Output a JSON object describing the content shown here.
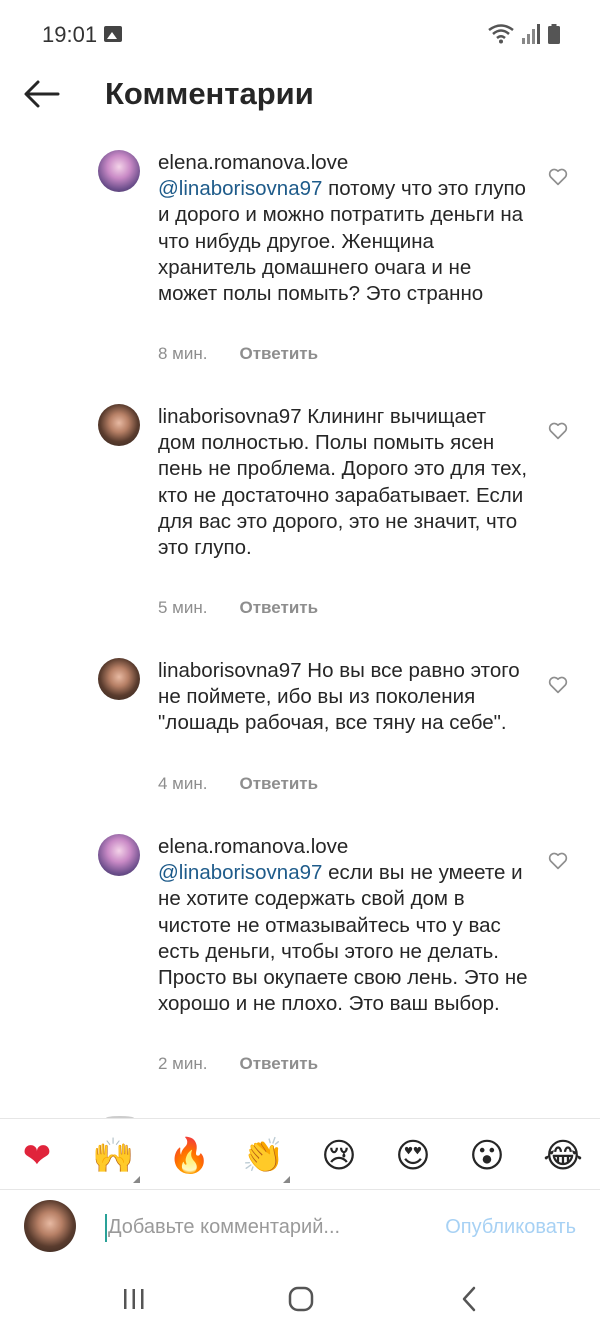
{
  "status": {
    "time": "19:01"
  },
  "header": {
    "title": "Комментарии"
  },
  "comments": [
    {
      "username": "elena.romanova.love",
      "mention": "@linaborisovna97",
      "text": " потому что это глупо и дорого и можно потратить деньги на что нибудь другое. Женщина хранитель домашнего очага и не может полы помыть? Это странно",
      "time": "8 мин.",
      "reply": "Ответить"
    },
    {
      "username": "linaborisovna97",
      "mention": "",
      "text": " Клининг вычищает дом полностью. Полы помыть ясен пень не проблема. Дорого это для тех, кто не достаточно зарабатывает. Если для вас это дорого, это не значит, что это глупо.",
      "time": "5 мин.",
      "reply": "Ответить"
    },
    {
      "username": "linaborisovna97",
      "mention": "",
      "text": " Но вы все равно этого не поймете, ибо вы из поколения \"лошадь рабочая, все тяну на себе\".",
      "time": "4 мин.",
      "reply": "Ответить"
    },
    {
      "username": "elena.romanova.love",
      "mention": "@linaborisovna97",
      "text": " если вы не умеете и не хотите содержать свой дом в чистоте не отмазывайтесь что у вас есть деньги, чтобы этого не делать. Просто вы окупаете свою лень. Это не хорошо и не плохо. Это ваш выбор.",
      "time": "2 мин.",
      "reply": "Ответить"
    }
  ],
  "emojis": [
    "❤",
    "🙌",
    "🔥",
    "👏",
    "😢",
    "😍",
    "😮",
    "😂"
  ],
  "composer": {
    "placeholder": "Добавьте комментарий...",
    "publish": "Опубликовать"
  }
}
